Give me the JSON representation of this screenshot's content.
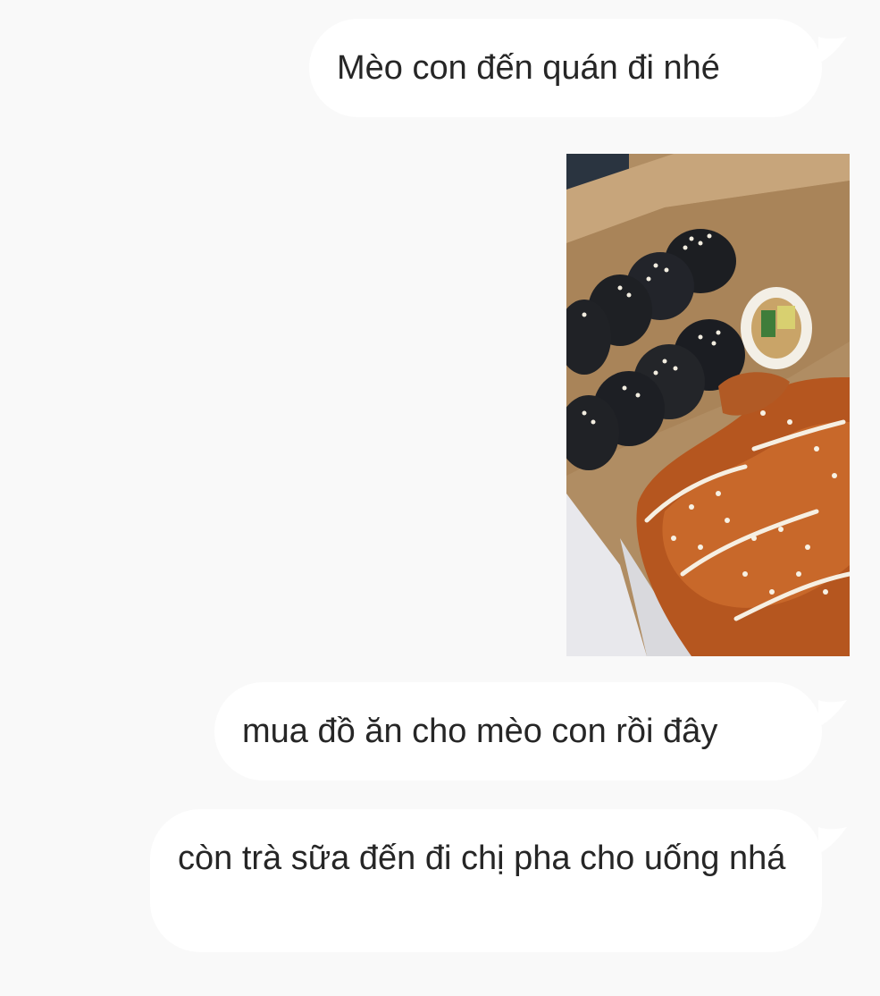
{
  "messages": [
    {
      "text": "Mèo con đến quán đi nhé"
    },
    {
      "image": "food-photo"
    },
    {
      "text": "mua đồ ăn cho mèo con rồi đây"
    },
    {
      "text": "còn trà sữa đến đi chị pha cho uống nhá"
    }
  ],
  "colors": {
    "background": "#f9f9f9",
    "bubble": "#ffffff",
    "text": "#262626"
  }
}
